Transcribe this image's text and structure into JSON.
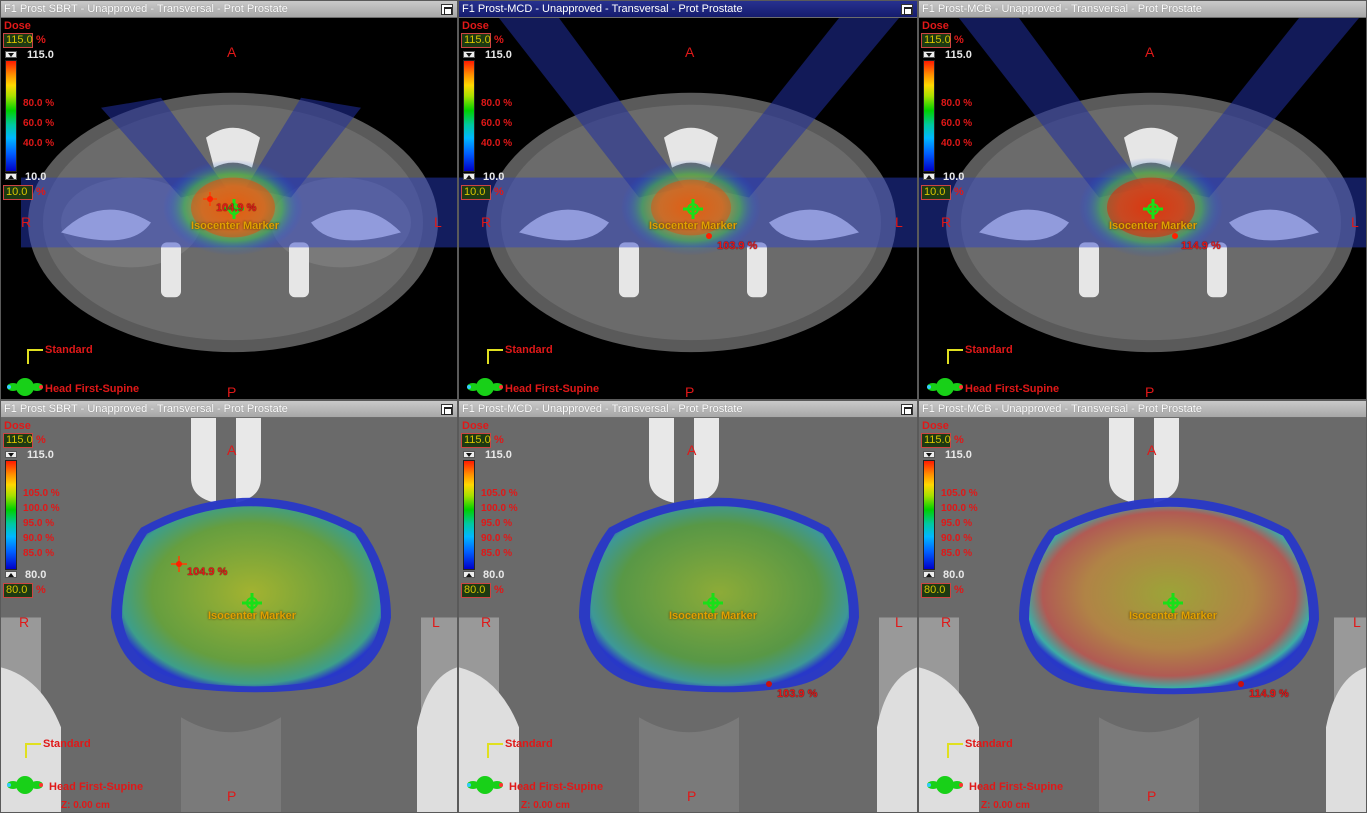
{
  "panes": [
    {
      "title": "F1 Prost SBRT  -  Unapproved - Transversal - Prot Prostate",
      "active": false,
      "dose_label": "Dose",
      "dose_max": "115.0",
      "dose_min": "10.0",
      "unit": "%",
      "cbar_top": "115.0",
      "cbar_bottom": "10.0",
      "isolines": [
        "80.0 %",
        "60.0 %",
        "40.0 %"
      ],
      "orient": {
        "a": "A",
        "p": "P",
        "r": "R",
        "l": "L"
      },
      "marker": "Isocenter Marker",
      "dose_point": "104.9 %",
      "standard": "Standard",
      "position": "Head First-Supine"
    },
    {
      "title": "F1 Prost-MCD  -  Unapproved - Transversal - Prot Prostate",
      "active": true,
      "dose_label": "Dose",
      "dose_max": "115.0",
      "dose_min": "10.0",
      "unit": "%",
      "cbar_top": "115.0",
      "cbar_bottom": "10.0",
      "isolines": [
        "80.0 %",
        "60.0 %",
        "40.0 %"
      ],
      "orient": {
        "a": "A",
        "p": "P",
        "r": "R",
        "l": "L"
      },
      "marker": "Isocenter Marker",
      "dose_point": "103.9 %",
      "standard": "Standard",
      "position": "Head First-Supine"
    },
    {
      "title": "F1 Prost-MCB  -  Unapproved - Transversal - Prot Prostate",
      "active": false,
      "dose_label": "Dose",
      "dose_max": "115.0",
      "dose_min": "10.0",
      "unit": "%",
      "cbar_top": "115.0",
      "cbar_bottom": "10.0",
      "isolines": [
        "80.0 %",
        "60.0 %",
        "40.0 %"
      ],
      "orient": {
        "a": "A",
        "p": "P",
        "r": "R",
        "l": "L"
      },
      "marker": "Isocenter Marker",
      "dose_point": "114.9 %",
      "standard": "Standard",
      "position": "Head First-Supine"
    },
    {
      "title": "F1 Prost SBRT  -  Unapproved - Transversal - Prot Prostate",
      "active": false,
      "dose_label": "Dose",
      "dose_max": "115.0",
      "dose_min": "80.0",
      "unit": "%",
      "cbar_top": "115.0",
      "cbar_bottom": "80.0",
      "isolines": [
        "105.0 %",
        "100.0 %",
        "95.0 %",
        "90.0 %",
        "85.0 %"
      ],
      "orient": {
        "a": "A",
        "p": "P",
        "r": "R",
        "l": "L"
      },
      "marker": "Isocenter Marker",
      "dose_point": "104.9 %",
      "standard": "Standard",
      "position": "Head First-Supine",
      "z": "Z: 0.00 cm"
    },
    {
      "title": "F1 Prost-MCD  -  Unapproved - Transversal - Prot Prostate",
      "active": false,
      "dose_label": "Dose",
      "dose_max": "115.0",
      "dose_min": "80.0",
      "unit": "%",
      "cbar_top": "115.0",
      "cbar_bottom": "80.0",
      "isolines": [
        "105.0 %",
        "100.0 %",
        "95.0 %",
        "90.0 %",
        "85.0 %"
      ],
      "orient": {
        "a": "A",
        "p": "P",
        "r": "R",
        "l": "L"
      },
      "marker": "Isocenter Marker",
      "dose_point": "103.9 %",
      "standard": "Standard",
      "position": "Head First-Supine",
      "z": "Z: 0.00 cm"
    },
    {
      "title": "F1 Prost-MCB  -  Unapproved - Transversal - Prot Prostate",
      "active": false,
      "dose_label": "Dose",
      "dose_max": "115.0",
      "dose_min": "80.0",
      "unit": "%",
      "cbar_top": "115.0",
      "cbar_bottom": "80.0",
      "isolines": [
        "105.0 %",
        "100.0 %",
        "95.0 %",
        "90.0 %",
        "85.0 %"
      ],
      "orient": {
        "a": "A",
        "p": "P",
        "r": "R",
        "l": "L"
      },
      "marker": "Isocenter Marker",
      "dose_point": "114.9 %",
      "standard": "Standard",
      "position": "Head First-Supine",
      "z": "Z: 0.00 cm"
    }
  ]
}
